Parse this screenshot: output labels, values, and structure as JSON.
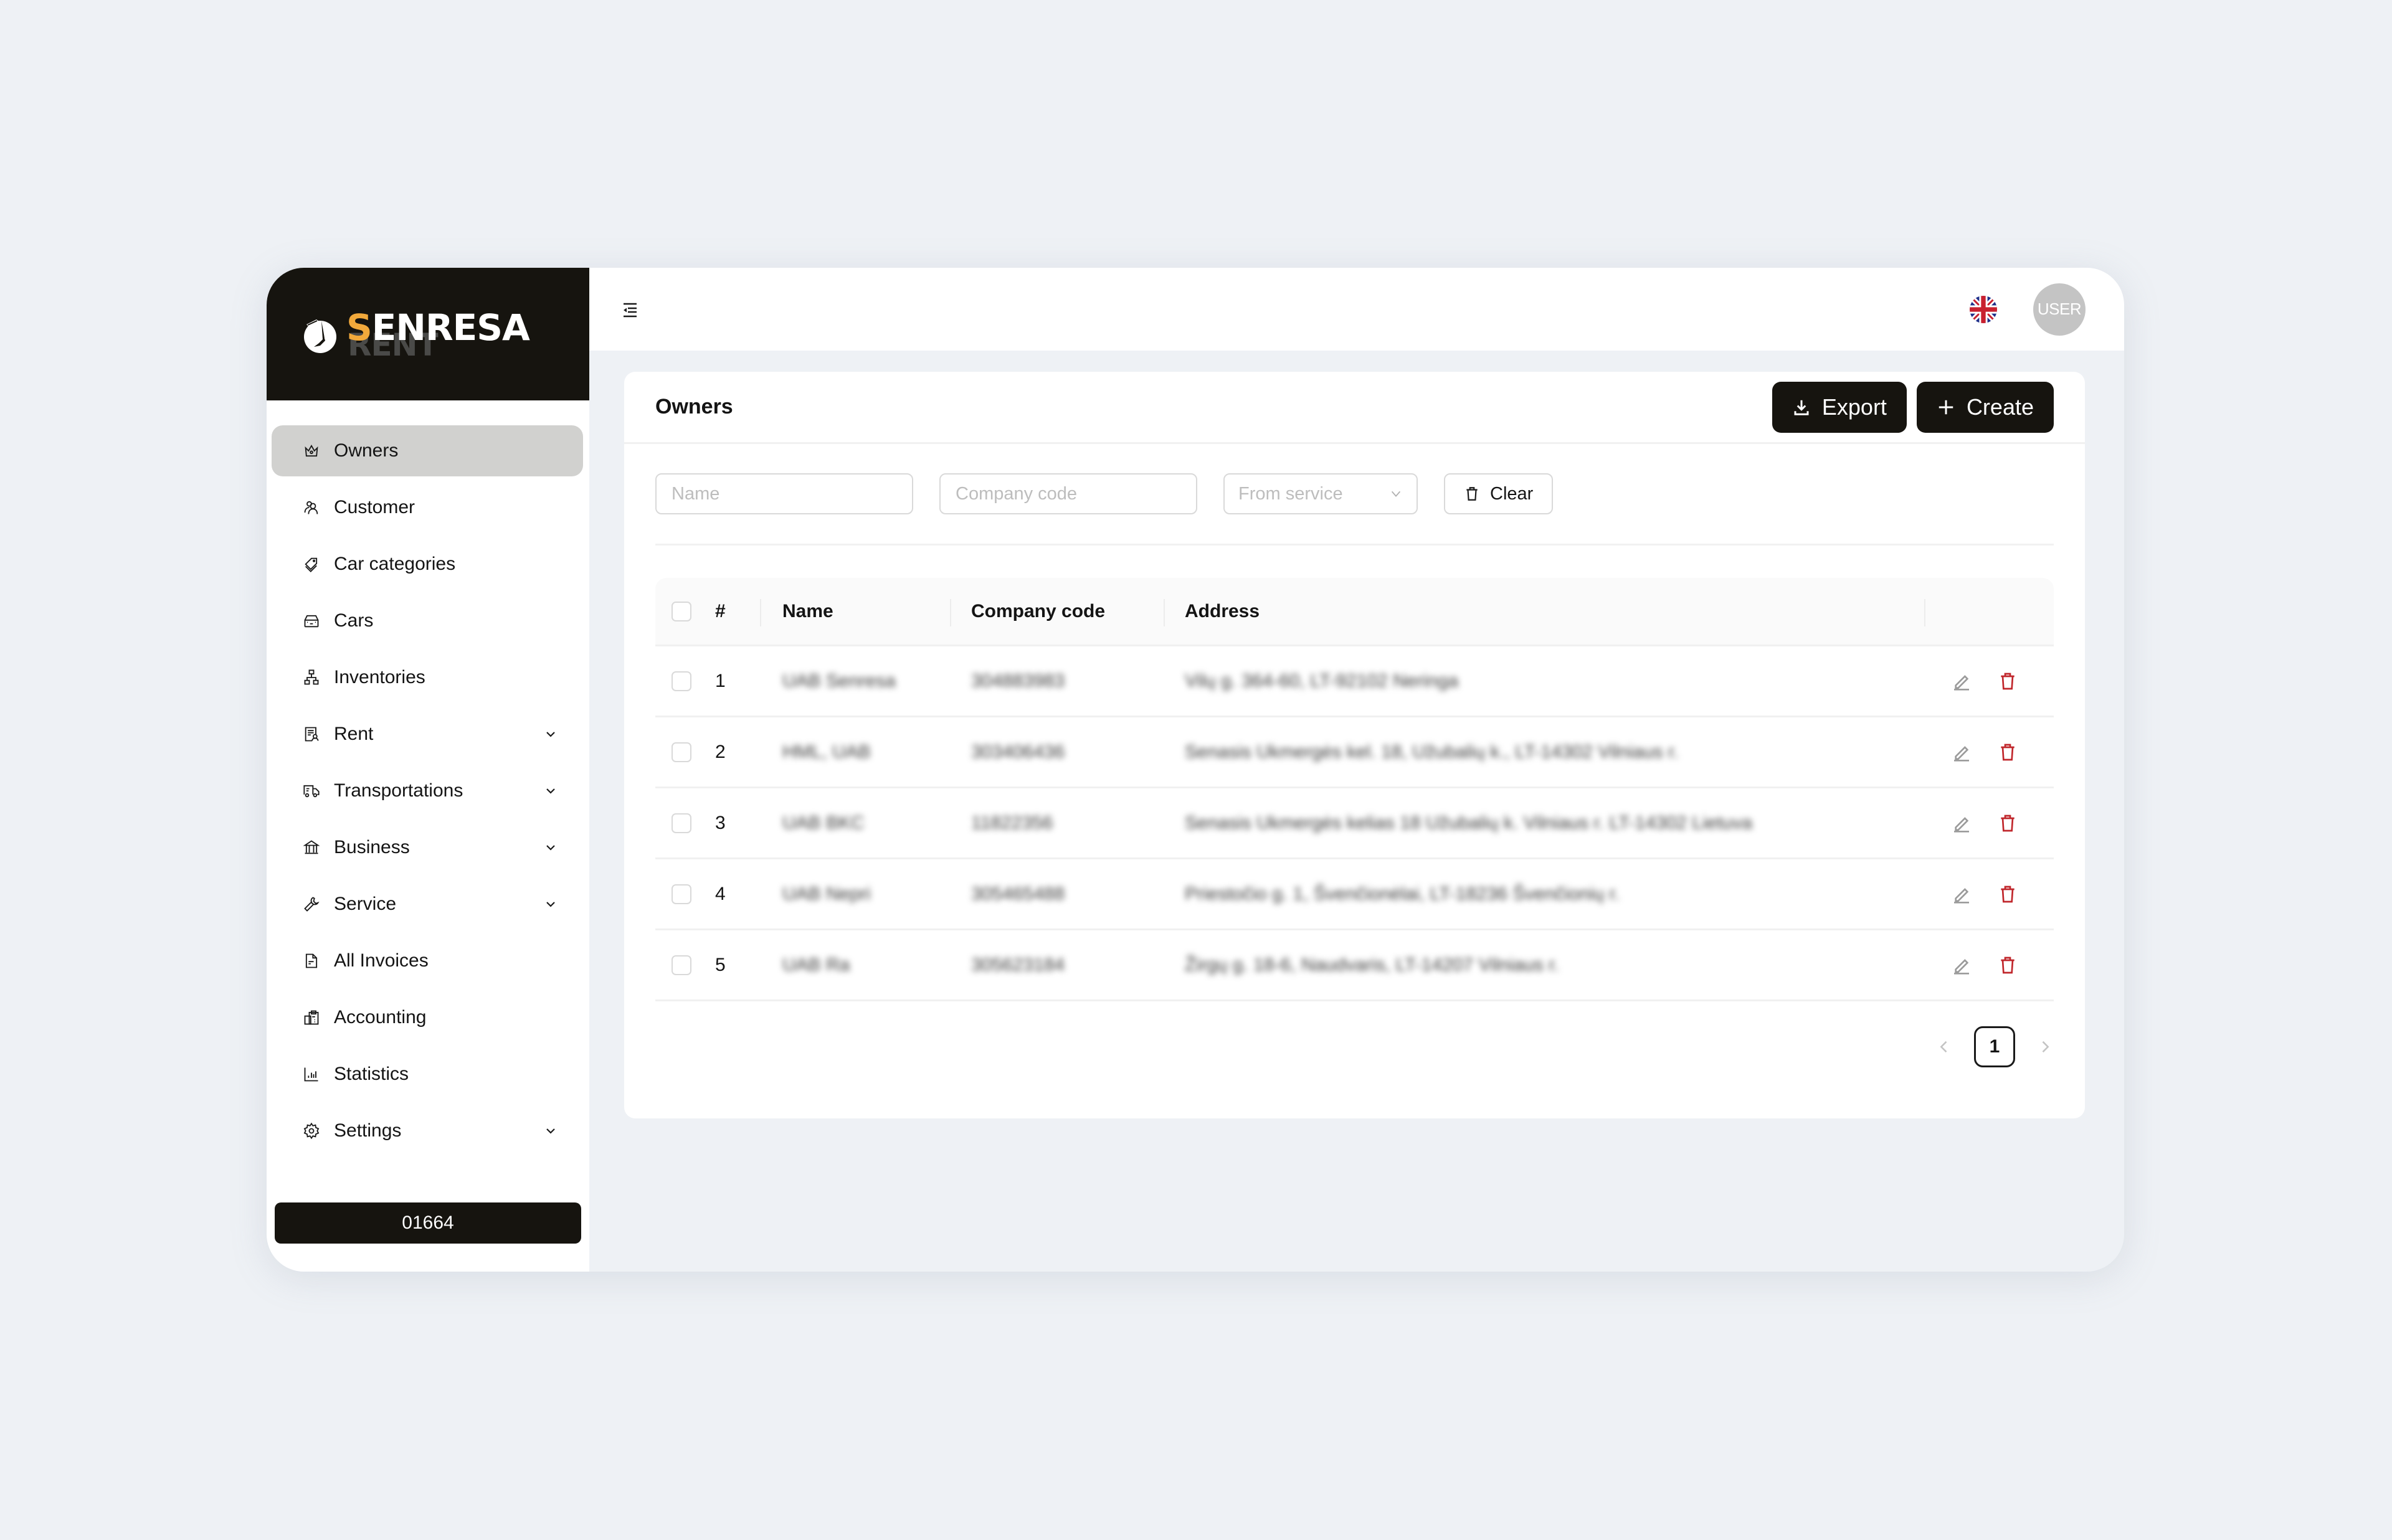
{
  "brand": {
    "name_accent": "S",
    "name_rest": "ENRESA",
    "sub": "RENT",
    "accent_color": "#f2a93b"
  },
  "sidebar": {
    "items": [
      {
        "label": "Owners",
        "icon": "crown-icon",
        "active": true,
        "expandable": false
      },
      {
        "label": "Customer",
        "icon": "users-icon",
        "active": false,
        "expandable": false
      },
      {
        "label": "Car categories",
        "icon": "tags-icon",
        "active": false,
        "expandable": false
      },
      {
        "label": "Cars",
        "icon": "car-icon",
        "active": false,
        "expandable": false
      },
      {
        "label": "Inventories",
        "icon": "hierarchy-icon",
        "active": false,
        "expandable": false
      },
      {
        "label": "Rent",
        "icon": "contract-icon",
        "active": false,
        "expandable": true
      },
      {
        "label": "Transportations",
        "icon": "truck-icon",
        "active": false,
        "expandable": true
      },
      {
        "label": "Business",
        "icon": "bank-icon",
        "active": false,
        "expandable": true
      },
      {
        "label": "Service",
        "icon": "wrench-icon",
        "active": false,
        "expandable": true
      },
      {
        "label": "All Invoices",
        "icon": "file-icon",
        "active": false,
        "expandable": false
      },
      {
        "label": "Accounting",
        "icon": "accounting-icon",
        "active": false,
        "expandable": false
      },
      {
        "label": "Statistics",
        "icon": "bar-chart-icon",
        "active": false,
        "expandable": false
      },
      {
        "label": "Settings",
        "icon": "gear-icon",
        "active": false,
        "expandable": true
      }
    ],
    "version": "01664"
  },
  "topbar": {
    "language": "English (UK)",
    "avatar_label": "USER"
  },
  "page": {
    "title": "Owners",
    "export_label": "Export",
    "create_label": "Create"
  },
  "filters": {
    "name_placeholder": "Name",
    "company_code_placeholder": "Company code",
    "from_service_placeholder": "From service",
    "clear_label": "Clear"
  },
  "table": {
    "columns": [
      "#",
      "Name",
      "Company code",
      "Address"
    ],
    "rows": [
      {
        "num": "1",
        "name": "UAB Senresa",
        "code": "304883983",
        "address": "Vilų g. 364-60, LT-92102 Neringa",
        "blurred": true
      },
      {
        "num": "2",
        "name": "HML, UAB",
        "code": "303406436",
        "address": "Senasis Ukmergės kel. 18, Užubalių k., LT-14302 Vilniaus r.",
        "blurred": true
      },
      {
        "num": "3",
        "name": "UAB BKC",
        "code": "11822356",
        "address": "Senasis Ukmergės kelias 18 Užubalių k. Vilniaus r. LT-14302 Lietuva",
        "blurred": true
      },
      {
        "num": "4",
        "name": "UAB Nepri",
        "code": "305465488",
        "address": "Priestočio g. 1, Švenčionėlai, LT-18236 Švenčionių r.",
        "blurred": true
      },
      {
        "num": "5",
        "name": "UAB Ra",
        "code": "305623184",
        "address": "Žirgų g. 18-6, Naudvaris, LT-14207 Vilniaus r.",
        "blurred": true
      }
    ]
  },
  "pagination": {
    "current_page": "1"
  }
}
